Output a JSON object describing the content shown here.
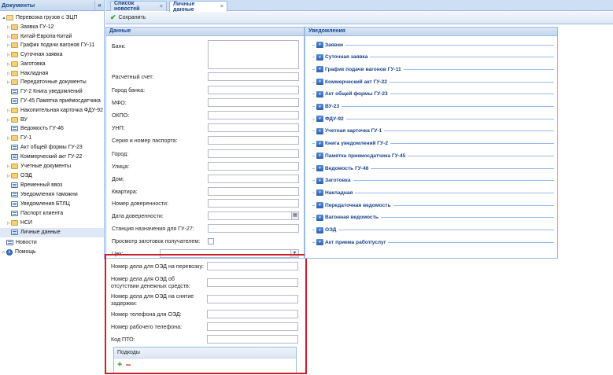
{
  "sidebar": {
    "title": "Документы",
    "collapse_glyph": "«",
    "items": [
      {
        "label": "Перевозка грузов с ЭЦП",
        "icon": "folder-open-icon",
        "level": 0,
        "toggle": "▲"
      },
      {
        "label": "Заявка ГУ-12",
        "icon": "folder-icon",
        "level": 1,
        "toggle": "▷"
      },
      {
        "label": "Китай-Европа-Китай",
        "icon": "folder-icon",
        "level": 1,
        "toggle": "▷"
      },
      {
        "label": "График подачи вагонов ГУ-11",
        "icon": "folder-icon",
        "level": 1,
        "toggle": "▷"
      },
      {
        "label": "Суточная заявка",
        "icon": "folder-icon",
        "level": 1,
        "toggle": "▷"
      },
      {
        "label": "Заготовка",
        "icon": "folder-icon",
        "level": 1,
        "toggle": "▷"
      },
      {
        "label": "Накладная",
        "icon": "folder-icon",
        "level": 1,
        "toggle": "▷"
      },
      {
        "label": "Передаточные документы",
        "icon": "folder-icon",
        "level": 1,
        "toggle": "▷"
      },
      {
        "label": "ГУ-2 Книга уведомлений",
        "icon": "doc-icon",
        "level": 1,
        "toggle": ""
      },
      {
        "label": "ГУ-45 Памятка приёмосдатчика",
        "icon": "doc-icon",
        "level": 1,
        "toggle": ""
      },
      {
        "label": "Накопительная карточка ФДУ-92",
        "icon": "folder-icon",
        "level": 1,
        "toggle": "▷"
      },
      {
        "label": "ВУ",
        "icon": "folder-icon",
        "level": 1,
        "toggle": "▷"
      },
      {
        "label": "Ведомость ГУ-46",
        "icon": "doc-icon",
        "level": 1,
        "toggle": ""
      },
      {
        "label": "ГУ-1",
        "icon": "folder-icon",
        "level": 1,
        "toggle": "▷"
      },
      {
        "label": "Акт общей формы ГУ-23",
        "icon": "doc-icon",
        "level": 1,
        "toggle": ""
      },
      {
        "label": "Коммерческий акт ГУ-22",
        "icon": "doc-icon",
        "level": 1,
        "toggle": ""
      },
      {
        "label": "Учетные документы",
        "icon": "folder-icon",
        "level": 1,
        "toggle": "▷"
      },
      {
        "label": "ОЭД",
        "icon": "folder-icon",
        "level": 1,
        "toggle": "▷"
      },
      {
        "label": "Временный ввоз",
        "icon": "doc-icon",
        "level": 1,
        "toggle": ""
      },
      {
        "label": "Уведомления таможни",
        "icon": "doc-icon",
        "level": 1,
        "toggle": ""
      },
      {
        "label": "Уведомления БТЛЦ",
        "icon": "doc-icon",
        "level": 1,
        "toggle": ""
      },
      {
        "label": "Паспорт клиента",
        "icon": "doc-icon",
        "level": 1,
        "toggle": ""
      },
      {
        "label": "НСИ",
        "icon": "folder-icon",
        "level": 1,
        "toggle": "▷"
      },
      {
        "label": "Личные данные",
        "icon": "doc-icon",
        "level": 1,
        "toggle": ""
      },
      {
        "label": "Новости",
        "icon": "doc-icon",
        "level": 0,
        "toggle": ""
      },
      {
        "label": "Помощь",
        "icon": "info-icon",
        "level": 0,
        "toggle": "▷"
      }
    ]
  },
  "tabs": [
    {
      "label": "Список новостей",
      "close": "×"
    },
    {
      "label": "Личные данные",
      "close": "×"
    }
  ],
  "toolbar": {
    "save_label": "Сохранить",
    "save_glyph": "✔"
  },
  "data_panel": {
    "title": "Данные",
    "fields": {
      "bank": "Банк:",
      "account": "Расчетный счет:",
      "bank_city": "Город банка:",
      "mfo": "МФО:",
      "okpo": "ОКПО:",
      "unp": "УНП:",
      "passport": "Серия и номер паспорта:",
      "city": "Город:",
      "street": "Улица:",
      "house": "Дом:",
      "apartment": "Квартира:",
      "power_num": "Номер доверенности:",
      "power_date": "Дата доверенности:",
      "station": "Станция назначения для ГУ-27:",
      "view_prep": "Просмотр заготовок получателем:",
      "shop": "Цех:",
      "oed_case": "Номер дела для ОЭД на перевозку:",
      "oed_no_funds": "Номер дела для ОЭД об отсутствии денежных средств:",
      "oed_delay": "Номер дела для ОЭД на снятие задержки:",
      "oed_phone": "Номер телефона для ОЭД:",
      "work_phone": "Номер рабочего телефона:",
      "pto_code": "Код ПТО:"
    },
    "subdivisions": {
      "title": "Подкоды",
      "add": "+",
      "remove": "−"
    },
    "combo_glyph": "▾",
    "cal_glyph": "▦"
  },
  "notif_panel": {
    "title": "Уведомления",
    "dd_glyph": "▾",
    "items": [
      "Заявки",
      "Суточная заявка",
      "График подачи вагонов ГУ-11",
      "Коммерческий акт ГУ-22",
      "Акт общей формы ГУ-23",
      "ВУ-23",
      "ФДУ-92",
      "Учетная карточка ГУ-1",
      "Книга уведомлений ГУ-2",
      "Памятка приемосдатчика ГУ-45",
      "Ведомость ГУ-46",
      "Заготовка",
      "Накладная",
      "Передаточная ведомость",
      "Вагонная ведомость",
      "ОЭД",
      "Акт приема работ/услуг"
    ]
  },
  "colors": {
    "accent": "#15428b",
    "border": "#99bbe8",
    "highlight": "#cc1f2a"
  }
}
